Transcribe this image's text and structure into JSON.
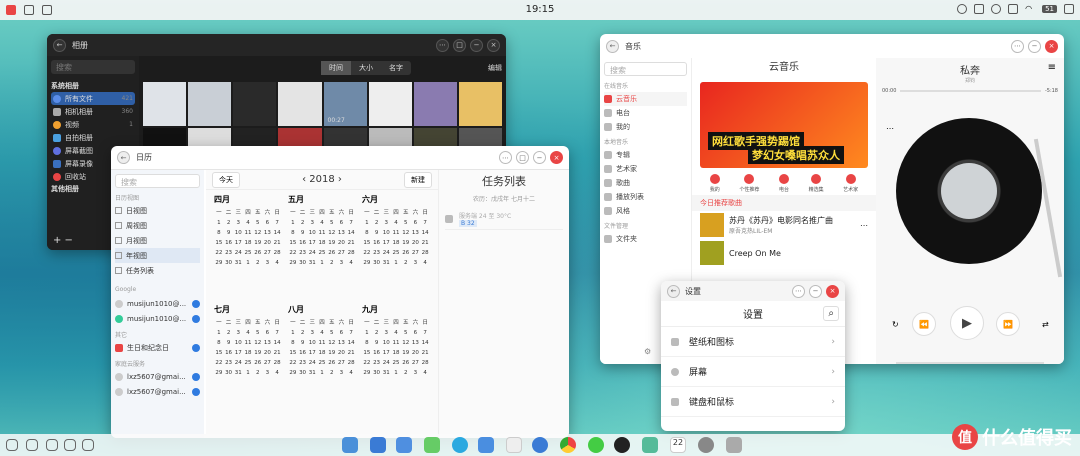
{
  "topbar": {
    "time": "19:15",
    "battery": "51"
  },
  "photos": {
    "title": "相册",
    "search": "搜索",
    "tabs": [
      "时间",
      "大小",
      "名字"
    ],
    "edit": "编辑",
    "sys_header": "系统相册",
    "items": [
      {
        "label": "所有文件",
        "count": "421"
      },
      {
        "label": "相机相册",
        "count": "360"
      },
      {
        "label": "视频",
        "count": "1"
      },
      {
        "label": "自拍相册",
        "count": ""
      },
      {
        "label": "屏幕截图",
        "count": "60"
      },
      {
        "label": "屏幕录像",
        "count": ""
      },
      {
        "label": "回收站",
        "count": ""
      }
    ],
    "other_header": "其他相册",
    "video_time": "00:27"
  },
  "calendar": {
    "title": "日历",
    "search": "搜索",
    "today": "今天",
    "year": "2018",
    "new": "新建",
    "tasks_title": "任务列表",
    "tasks_sub": "农历：戊戌年 七月十二",
    "task_item": "服务端 24 至 30°C",
    "task_tag": "⁠B 32",
    "side_header": "日历视图",
    "views": [
      "日视图",
      "周视图",
      "月视图",
      "年视图",
      "任务列表"
    ],
    "google_header": "Google",
    "google_items": [
      "musijun1010@...",
      "musijun1010@..."
    ],
    "other_header": "其它",
    "other_items": [
      "生日和纪念日"
    ],
    "family_header": "家庭云服务",
    "family_items": [
      "lxz5607@gmai...",
      "lxz5607@gmai..."
    ],
    "months": [
      "四月",
      "五月",
      "六月",
      "七月",
      "八月",
      "九月"
    ],
    "weekdays": [
      "一",
      "二",
      "三",
      "四",
      "五",
      "六",
      "日"
    ]
  },
  "music": {
    "title": "音乐",
    "search": "搜索",
    "header": "云音乐",
    "now_title": "私奔",
    "now_artist": "郑钧",
    "time_start": "00:00",
    "time_end": "-5:18",
    "side_h1": "在线音乐",
    "side1": [
      "云音乐",
      "电台",
      "我的"
    ],
    "side_h2": "本地音乐",
    "side2": [
      "专辑",
      "艺术家",
      "歌曲",
      "播放列表",
      "风格"
    ],
    "side_h3": "文件管理",
    "side3": [
      "文件夹"
    ],
    "banner_line1": "网红歌手强势踢馆",
    "banner_line2": "梦幻女嗓唱苏众人",
    "cats": [
      "我的",
      "个性推荐",
      "电台",
      "精选集",
      "艺术家"
    ],
    "rec_header": "今日推荐歌曲",
    "songs": [
      {
        "title": "苏丹《苏丹》电影同名推广曲",
        "artist": "原吾克热LIL-EM"
      },
      {
        "title": "Creep On Me",
        "artist": ""
      }
    ]
  },
  "settings": {
    "title": "设置",
    "header": "设置",
    "items": [
      "壁纸和图标",
      "屏幕",
      "键盘和鼠标"
    ]
  },
  "watermark": {
    "badge": "值",
    "text": "什么值得买"
  }
}
